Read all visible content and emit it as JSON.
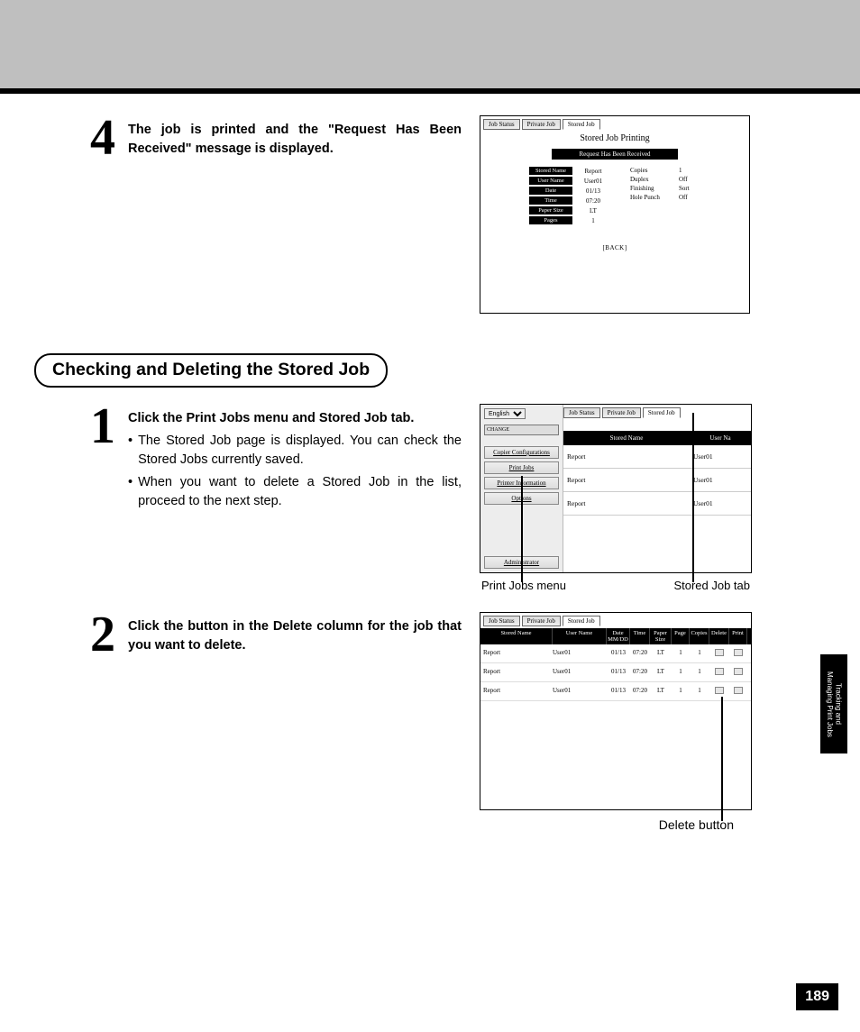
{
  "step4": {
    "number": "4",
    "text": "The job is printed and the \"Request Has Been Received\" message is displayed."
  },
  "shot1": {
    "tabs": [
      "Job Status",
      "Private Job",
      "Stored Job"
    ],
    "activeTab": 2,
    "title": "Stored Job Printing",
    "message": "Request Has Been Received",
    "left": [
      {
        "label": "Stored Name",
        "value": "Report"
      },
      {
        "label": "User Name",
        "value": "User01"
      },
      {
        "label": "Date",
        "value": "01/13"
      },
      {
        "label": "Time",
        "value": "07:20"
      },
      {
        "label": "Paper Size",
        "value": "LT"
      },
      {
        "label": "Pages",
        "value": "1"
      }
    ],
    "right": [
      {
        "label": "Copies",
        "value": "1"
      },
      {
        "label": "Duplex",
        "value": "Off"
      },
      {
        "label": "Finishing",
        "value": "Sort"
      },
      {
        "label": "Hole Punch",
        "value": "Off"
      }
    ],
    "back": "[BACK]"
  },
  "section": {
    "title": "Checking and Deleting the Stored Job"
  },
  "step1": {
    "number": "1",
    "title": "Click the Print Jobs menu and Stored Job tab.",
    "bullets": [
      "The Stored Job page is displayed.  You can check the Stored Jobs currently saved.",
      "When you want to delete a Stored Job in the list, proceed to the next step."
    ]
  },
  "shot2": {
    "lang": "English",
    "change": "CHANGE",
    "sidebar": [
      "Copier Configurations",
      "Print Jobs",
      "Printer Information",
      "Options"
    ],
    "sidebarBottom": "Administrator",
    "tabs": [
      "Job Status",
      "Private Job",
      "Stored Job"
    ],
    "headers": [
      "Stored Name",
      "User Na"
    ],
    "rows": [
      {
        "name": "Report",
        "user": "User01"
      },
      {
        "name": "Report",
        "user": "User01"
      },
      {
        "name": "Report",
        "user": "User01"
      }
    ],
    "captionLeft": "Print Jobs menu",
    "captionRight": "Stored Job tab"
  },
  "step2": {
    "number": "2",
    "text": "Click the button in the Delete column for the job that you want to delete."
  },
  "shot3": {
    "tabs": [
      "Job Status",
      "Private Job",
      "Stored Job"
    ],
    "headers": [
      "Stored Name",
      "User Name",
      "Date MM/DD",
      "Time",
      "Paper Size",
      "Page",
      "Copies",
      "Delete",
      "Print"
    ],
    "rows": [
      {
        "name": "Report",
        "user": "User01",
        "date": "01/13",
        "time": "07:20",
        "size": "LT",
        "page": "1",
        "copies": "1"
      },
      {
        "name": "Report",
        "user": "User01",
        "date": "01/13",
        "time": "07:20",
        "size": "LT",
        "page": "1",
        "copies": "1"
      },
      {
        "name": "Report",
        "user": "User01",
        "date": "01/13",
        "time": "07:20",
        "size": "LT",
        "page": "1",
        "copies": "1"
      }
    ],
    "caption": "Delete button"
  },
  "sideTab": {
    "line1": "Tracking and",
    "line2": "Managing Print Jobs"
  },
  "pageNumber": "189"
}
